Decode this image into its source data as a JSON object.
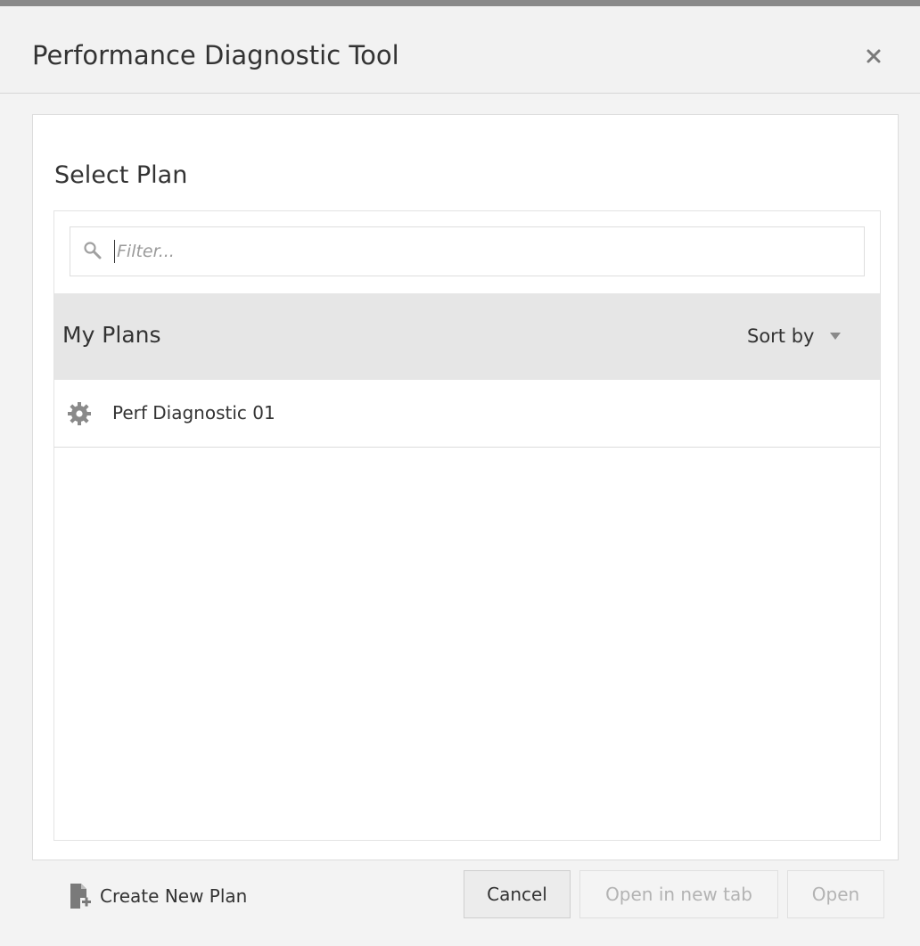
{
  "dialog": {
    "title": "Performance Diagnostic Tool",
    "close_icon": "close-icon"
  },
  "panel": {
    "section_title": "Select Plan",
    "filter": {
      "placeholder": "Filter...",
      "icon": "search-icon"
    },
    "list": {
      "header_title": "My Plans",
      "sort_label": "Sort by",
      "items": [
        {
          "label": "Perf Diagnostic 01",
          "icon": "gear-icon"
        }
      ]
    }
  },
  "footer": {
    "create_label": "Create New Plan",
    "create_icon": "new-document-icon",
    "cancel_label": "Cancel",
    "open_new_tab_label": "Open in new tab",
    "open_label": "Open"
  },
  "colors": {
    "header_band": "#e6e6e6",
    "disabled_text": "#b3b3b3",
    "icon_gray": "#8a8a8a"
  }
}
